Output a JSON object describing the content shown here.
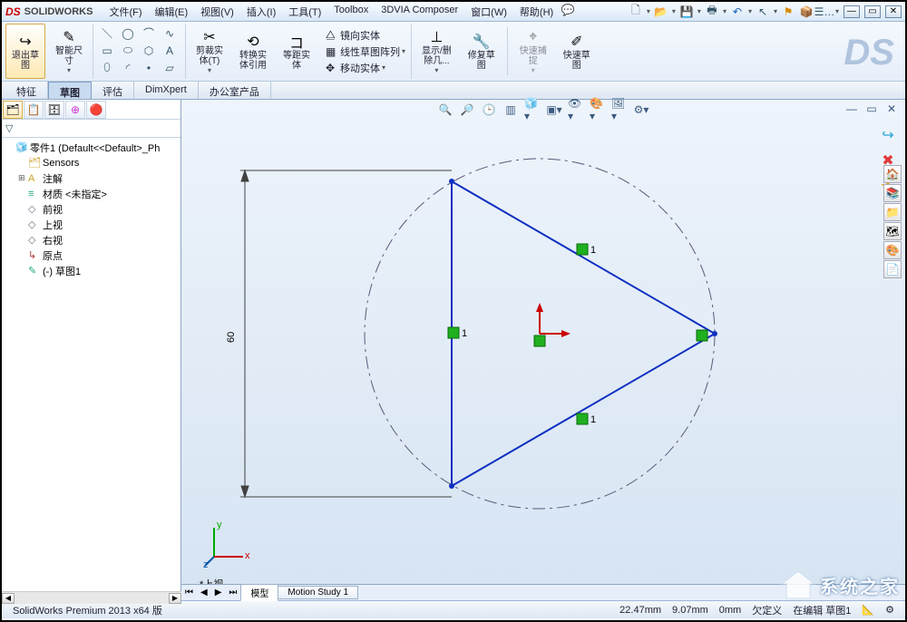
{
  "app": {
    "logo": "SOLIDWORKS"
  },
  "menu": {
    "file": "文件(F)",
    "edit": "编辑(E)",
    "view": "视图(V)",
    "insert": "插入(I)",
    "tools": "工具(T)",
    "toolbox": "Toolbox",
    "composer": "3DVIA Composer",
    "window": "窗口(W)",
    "help": "帮助(H)"
  },
  "qat": {
    "star": "★"
  },
  "ribbon": {
    "exit_sketch": "退出草\n图",
    "smart_dim": "智能尺\n寸",
    "trim": "剪裁实\n体(T)",
    "convert": "转换实\n体引用",
    "offset": "等距实\n体",
    "mirror": "镜向实体",
    "linpattern": "线性草图阵列",
    "move": "移动实体",
    "show_hide": "显示/删\n除几...",
    "repair": "修复草\n图",
    "quick_snap": "快速捕\n捉",
    "quick_sketch": "快速草\n图"
  },
  "cmdtabs": {
    "features": "特征",
    "sketch": "草图",
    "evaluate": "评估",
    "dimxpert": "DimXpert",
    "office": "办公室产品"
  },
  "fm": {
    "part": "零件1  (Default<<Default>_Ph",
    "sensors": "Sensors",
    "annotations": "注解",
    "material": "材质 <未指定>",
    "front": "前视",
    "top": "上视",
    "right": "右视",
    "origin": "原点",
    "sketch1": "(-) 草图1"
  },
  "dimension": "60",
  "constraint_label": "1",
  "triad": {
    "x": "x",
    "y": "y",
    "z": "z"
  },
  "view_name": "*上视",
  "bottom": {
    "model": "模型",
    "motion": "Motion Study 1"
  },
  "status": {
    "product": "SolidWorks Premium 2013 x64 版",
    "x": "22.47mm",
    "y": "9.07mm",
    "z": "0mm",
    "defined": "欠定义",
    "editing": "在编辑 草图1"
  },
  "watermark": "系统之家"
}
